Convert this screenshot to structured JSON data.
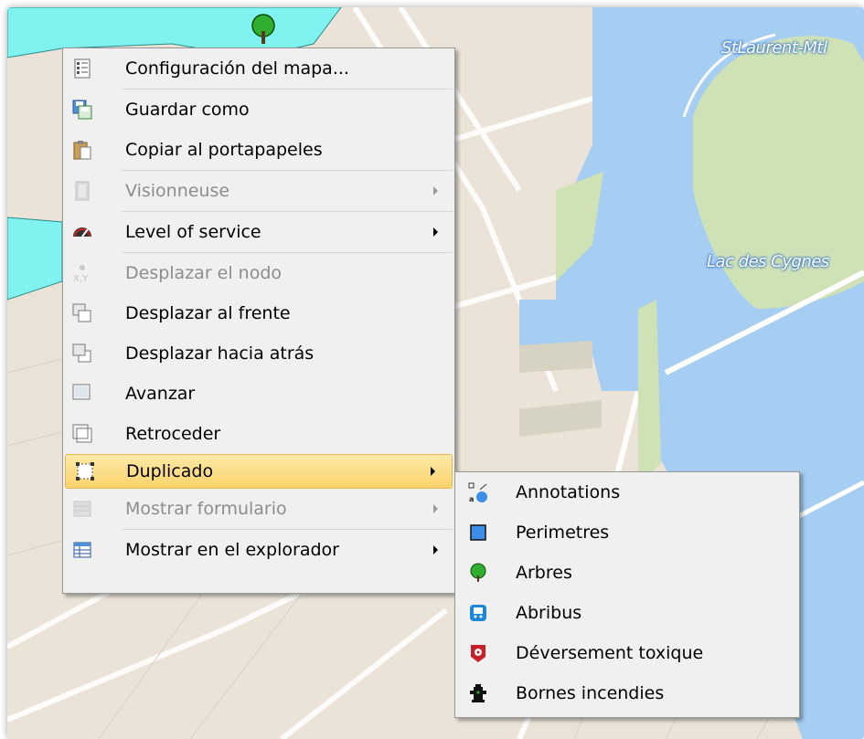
{
  "map": {
    "labels": [
      "StLaurent-Mtl",
      "Lac des Cygnes"
    ],
    "colors": {
      "water": "#a6cdf2",
      "land": "#ebe3d7",
      "park": "#cfe2b6",
      "parcel": "#80f2f0",
      "road": "#ffffff"
    }
  },
  "context_menu": {
    "items": [
      {
        "id": "config",
        "label": "Configuración del mapa...",
        "icon": "list-settings-icon",
        "disabled": false,
        "submenu": false
      },
      {
        "id": "save",
        "label": "Guardar como",
        "icon": "save-as-icon",
        "disabled": false,
        "submenu": false
      },
      {
        "id": "copy",
        "label": "Copiar al portapapeles",
        "icon": "clipboard-icon",
        "disabled": false,
        "submenu": false
      },
      {
        "id": "viewer",
        "label": "Visionneuse",
        "icon": "film-icon",
        "disabled": true,
        "submenu": true
      },
      {
        "id": "los",
        "label": "Level of service",
        "icon": "gauge-icon",
        "disabled": false,
        "submenu": true
      },
      {
        "id": "move-node",
        "label": "Desplazar el nodo",
        "icon": "move-node-icon",
        "disabled": true,
        "submenu": false
      },
      {
        "id": "bring-front",
        "label": "Desplazar al frente",
        "icon": "bring-to-front-icon",
        "disabled": false,
        "submenu": false
      },
      {
        "id": "send-back",
        "label": "Desplazar hacia atrás",
        "icon": "send-to-back-icon",
        "disabled": false,
        "submenu": false
      },
      {
        "id": "forward",
        "label": "Avanzar",
        "icon": "bring-forward-icon",
        "disabled": false,
        "submenu": false
      },
      {
        "id": "backward",
        "label": "Retroceder",
        "icon": "send-backward-icon",
        "disabled": false,
        "submenu": false
      },
      {
        "id": "duplicate",
        "label": "Duplicado",
        "icon": "duplicate-icon",
        "disabled": false,
        "submenu": true,
        "highlighted": true
      },
      {
        "id": "show-form",
        "label": "Mostrar formulario",
        "icon": "form-icon",
        "disabled": true,
        "submenu": true
      },
      {
        "id": "show-explorer",
        "label": "Mostrar en el explorador",
        "icon": "table-icon",
        "disabled": false,
        "submenu": true
      }
    ]
  },
  "submenu": {
    "items": [
      {
        "label": "Annotations",
        "icon": "annotations-icon"
      },
      {
        "label": "Perimetres",
        "icon": "perimeter-icon",
        "color": "#3d8ee8"
      },
      {
        "label": "Arbres",
        "icon": "tree-icon",
        "color": "#2fae2f"
      },
      {
        "label": "Abribus",
        "icon": "bus-stop-icon",
        "color": "#1e88d8"
      },
      {
        "label": "Déversement toxique",
        "icon": "toxic-spill-icon",
        "color": "#c8202a"
      },
      {
        "label": "Bornes incendies",
        "icon": "fire-hydrant-icon",
        "color": "#1a8a1a"
      }
    ]
  }
}
